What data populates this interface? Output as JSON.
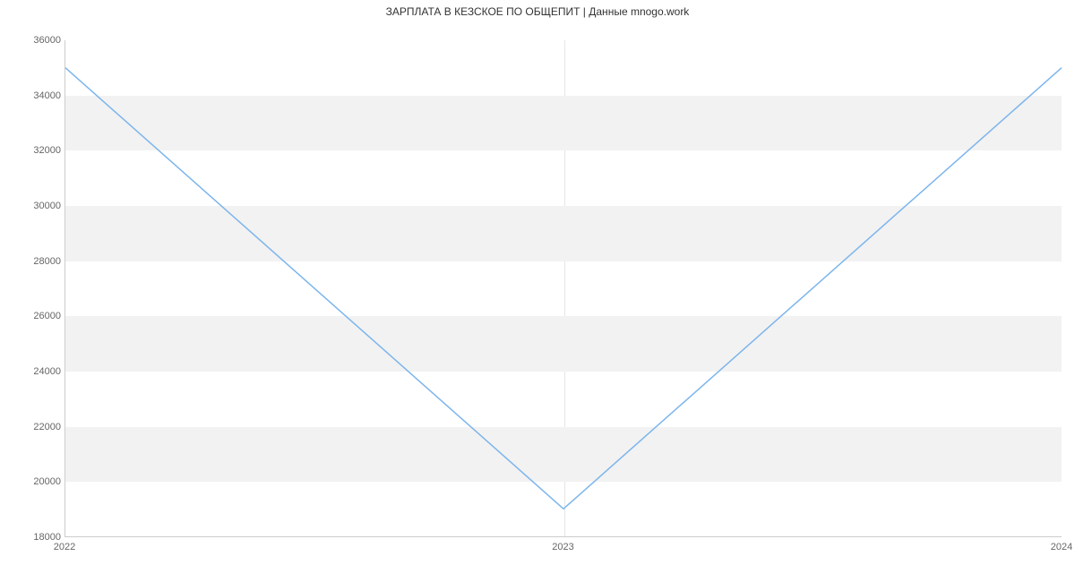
{
  "chart_data": {
    "type": "line",
    "title": "ЗАРПЛАТА В КЕЗСКОЕ ПО ОБЩЕПИТ | Данные mnogo.work",
    "xlabel": "",
    "ylabel": "",
    "x_ticks": [
      "2022",
      "2023",
      "2024"
    ],
    "y_ticks": [
      18000,
      20000,
      22000,
      24000,
      26000,
      28000,
      30000,
      32000,
      34000,
      36000
    ],
    "ylim": [
      18000,
      36000
    ],
    "xlim": [
      "2022",
      "2024"
    ],
    "categories": [
      "2022",
      "2023",
      "2024"
    ],
    "values": [
      35000,
      19000,
      35000
    ],
    "line_color": "#7cb5ec",
    "bands": true
  }
}
